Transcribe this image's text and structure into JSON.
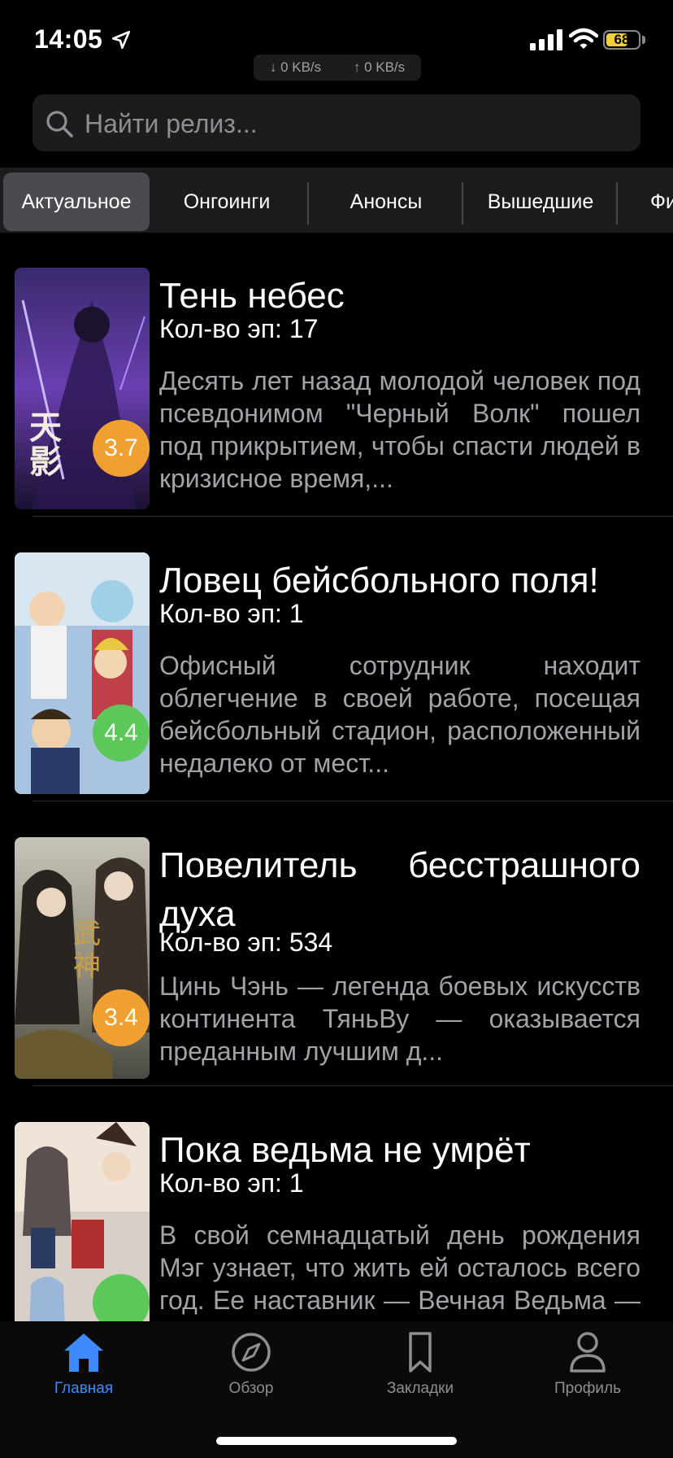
{
  "status": {
    "time": "14:05",
    "battery": "68",
    "battery_level": 0.68,
    "net_down": "↓ 0 KB/s",
    "net_up": "↑ 0 KB/s"
  },
  "search": {
    "placeholder": "Найти релиз..."
  },
  "tabs": [
    {
      "label": "Актуальное",
      "active": true
    },
    {
      "label": "Онгоинги"
    },
    {
      "label": "Анонсы"
    },
    {
      "label": "Вышедшие"
    },
    {
      "label": "Фи"
    }
  ],
  "items": [
    {
      "title": "Тень небес",
      "episodes": "Кол-во эп: 17",
      "description": "Десять лет назад молодой человек под псевдонимом \"Черный Волк\" пошел под прикрытием, чтобы спасти людей в кризисное время,...",
      "rating": "3.7",
      "rating_color": "#f0a030"
    },
    {
      "title": "Ловец бейсбольного поля!",
      "episodes": "Кол-во эп: 1",
      "description": "Офисный сотрудник находит облегчение в своей работе, посещая бейсбольный стадион, расположенный недалеко от мест...",
      "rating": "4.4",
      "rating_color": "#5cc85a"
    },
    {
      "title": "Повелитель бесстрашного духа",
      "episodes": "Кол-во эп: 534",
      "description": "Цинь Чэнь — легенда боевых искусств континента ТяньВу — оказывается преданным лучшим д...",
      "rating": "3.4",
      "rating_color": "#f0a030"
    },
    {
      "title": "Пока ведьма не умрёт",
      "episodes": "Кол-во эп: 1",
      "description": "В свой семнадцатый день рождения Мэг узнает, что жить ей осталось всего год. Ее наставник — Вечная Ведьма — говорит ей, что",
      "rating": "",
      "rating_color": "#5cc85a"
    }
  ],
  "nav": [
    {
      "label": "Главная",
      "icon": "home-icon",
      "active": true
    },
    {
      "label": "Обзор",
      "icon": "compass-icon"
    },
    {
      "label": "Закладки",
      "icon": "bookmark-icon"
    },
    {
      "label": "Профиль",
      "icon": "person-icon"
    }
  ],
  "colors": {
    "accent": "#3d8bff",
    "background": "#000000",
    "surface": "#1c1c1e"
  }
}
